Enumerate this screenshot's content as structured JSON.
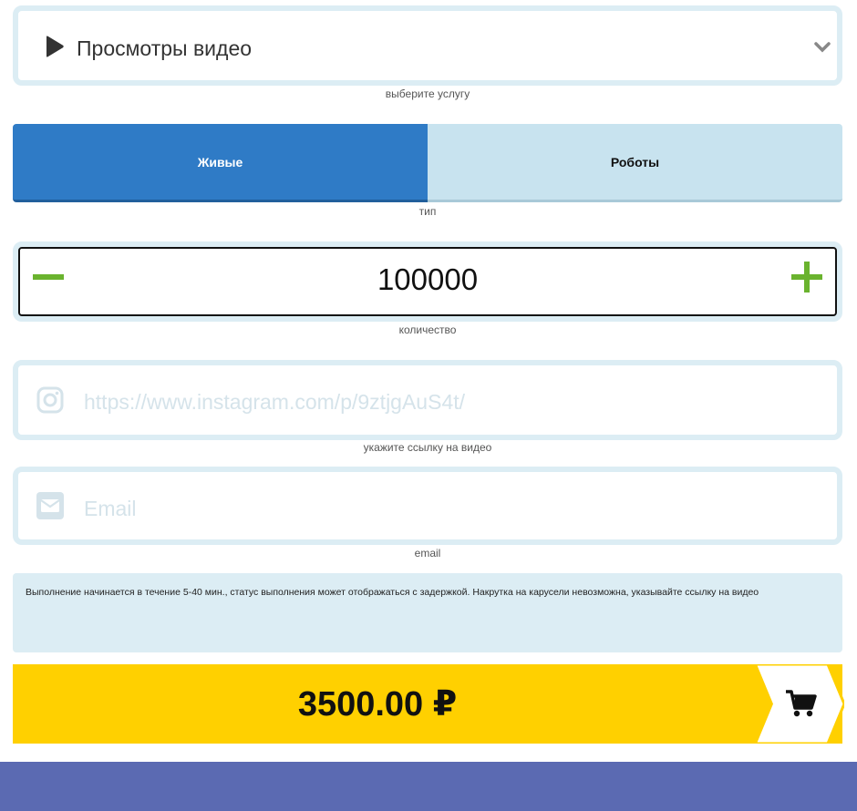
{
  "service": {
    "selected": "Просмотры видео",
    "caption": "выберите услугу"
  },
  "type": {
    "options": [
      "Живые",
      "Роботы"
    ],
    "selected": "Живые",
    "caption": "тип"
  },
  "quantity": {
    "value": "100000",
    "caption": "количество"
  },
  "link": {
    "placeholder": "https://www.instagram.com/p/9ztjgAuS4t/",
    "caption": "укажите ссылку на видео"
  },
  "email": {
    "placeholder": "Email",
    "caption": "email"
  },
  "info": {
    "text": "Выполнение начинается в течение 5-40 мин., статус выполнения может отображаться с задержкой. Накрутка на карусели невозможна, указывайте ссылку на видео"
  },
  "price": {
    "amount": "3500.00 ₽"
  },
  "colors": {
    "accent_blue": "#2f7bc6",
    "inactive_blue": "#c8e3ef",
    "green": "#6ab32e",
    "yellow": "#ffd000",
    "footer": "#5b6ab2",
    "border": "#dcedf4"
  },
  "icons": {
    "service": "play-icon",
    "dropdown": "chevron-down-icon",
    "link": "instagram-icon",
    "email": "envelope-icon",
    "cart": "cart-icon"
  }
}
